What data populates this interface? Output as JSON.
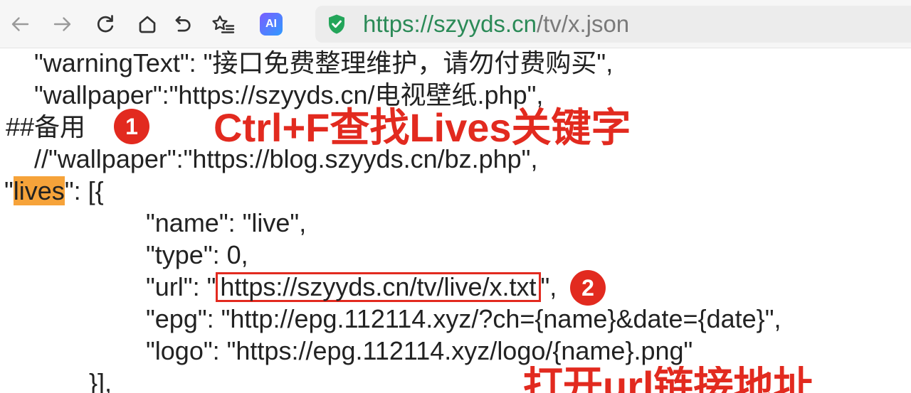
{
  "toolbar": {
    "buttons": [
      "back-arrow-icon",
      "forward-arrow-icon",
      "reload-icon",
      "home-icon",
      "undo-icon",
      "star-list-icon"
    ],
    "ai_label": "AI"
  },
  "address_bar": {
    "security_icon": "shield-check-icon",
    "scheme": "https://",
    "host": "szyyds.cn",
    "path": "/tv/x.json"
  },
  "document": {
    "lines": [
      "\"warningText\": \"接口免费整理维护，请勿付费购买\",",
      "\"wallpaper\":\"https://szyyds.cn/电视壁纸.php\",",
      "##备用",
      "//\"wallpaper\":\"https://blog.szyyds.cn/bz.php\",",
      {
        "open": "\"",
        "highlight": "lives",
        "rest": "\": [{"
      },
      "\"name\": \"live\",",
      "\"type\": 0,",
      {
        "prefix": "\"url\": \"",
        "url": "https://szyyds.cn/tv/live/x.txt",
        "suffix": "\","
      },
      "\"epg\": \"http://epg.112114.xyz/?ch={name}&date={date}\",",
      "\"logo\": \"https://epg.112114.xyz/logo/{name}.png\"",
      "}],"
    ]
  },
  "annotations": {
    "step1": {
      "number": "1",
      "text": "Ctrl+F查找Lives关键字"
    },
    "step2": {
      "number": "2",
      "text": "打开url链接地址"
    }
  },
  "colors": {
    "annotation_red": "#e22a1f",
    "find_highlight": "#f6a33a",
    "secure_green": "#23a55a",
    "url_green": "#2b8a57",
    "url_path_gray": "#7a7a7a",
    "text": "#222222",
    "toolbar_bg": "#f6f6f6",
    "address_bar_bg": "#ececec",
    "ai_gradient": [
      "#7b5cff",
      "#2f9bff"
    ]
  }
}
